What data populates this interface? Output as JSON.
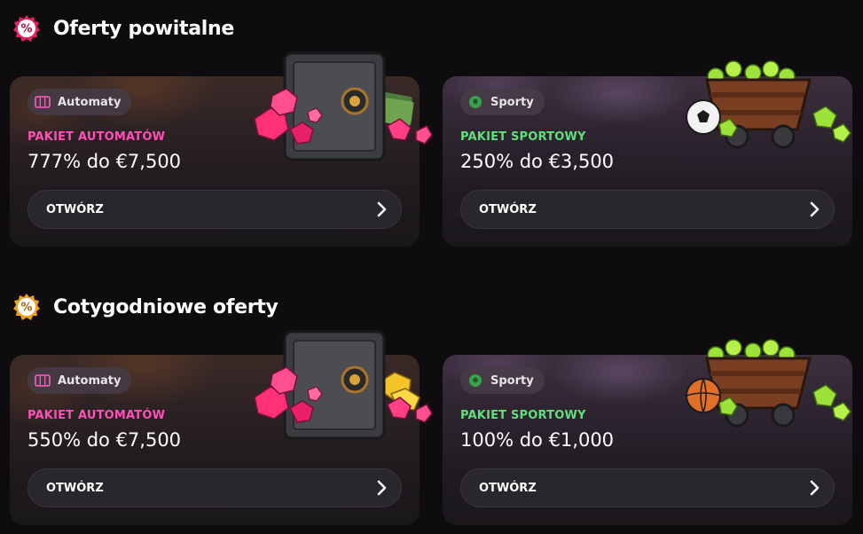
{
  "sections": [
    {
      "title": "Oferty powitalne",
      "badge_icon": "percent-badge-icon",
      "badge_color": "#e0245e",
      "cards": [
        {
          "kind": "slots",
          "chip_label": "Automaty",
          "chip_icon": "slot-machine-icon",
          "pack_label": "PAKIET AUTOMATÓW",
          "pack_value": "777% do €7,500",
          "button_label": "OTWÓRZ",
          "art": "safe-with-gems-and-cash"
        },
        {
          "kind": "sports",
          "chip_label": "Sporty",
          "chip_icon": "sports-ball-icon",
          "pack_label": "PAKIET SPORTOWY",
          "pack_value": "250% do €3,500",
          "button_label": "OTWÓRZ",
          "art": "mine-cart-with-soccer-ball"
        }
      ]
    },
    {
      "title": "Cotygodniowe oferty",
      "badge_icon": "percent-badge-icon",
      "badge_color": "#f0a020",
      "cards": [
        {
          "kind": "slots",
          "chip_label": "Automaty",
          "chip_icon": "slot-machine-icon",
          "pack_label": "PAKIET AUTOMATÓW",
          "pack_value": "550% do €7,500",
          "button_label": "OTWÓRZ",
          "art": "safe-with-gems-and-gold"
        },
        {
          "kind": "sports",
          "chip_label": "Sporty",
          "chip_icon": "sports-ball-icon",
          "pack_label": "PAKIET SPORTOWY",
          "pack_value": "100% do €1,000",
          "button_label": "OTWÓRZ",
          "art": "mine-cart-with-basketball"
        }
      ]
    }
  ],
  "colors": {
    "slots_accent": "#ff4fb8",
    "sports_accent": "#5fe07a",
    "background": "#0f0c10"
  }
}
